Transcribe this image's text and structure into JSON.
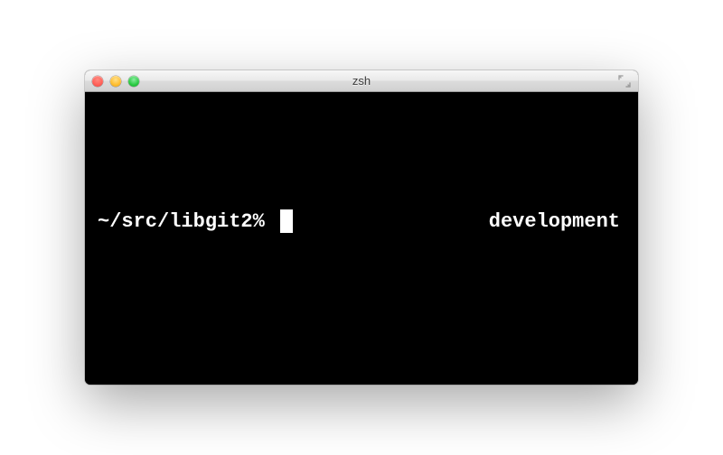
{
  "window": {
    "title": "zsh"
  },
  "traffic_lights": {
    "close": "close",
    "minimize": "minimize",
    "maximize": "maximize"
  },
  "terminal": {
    "prompt": "~/src/libgit2% ",
    "right_prompt": "development"
  }
}
